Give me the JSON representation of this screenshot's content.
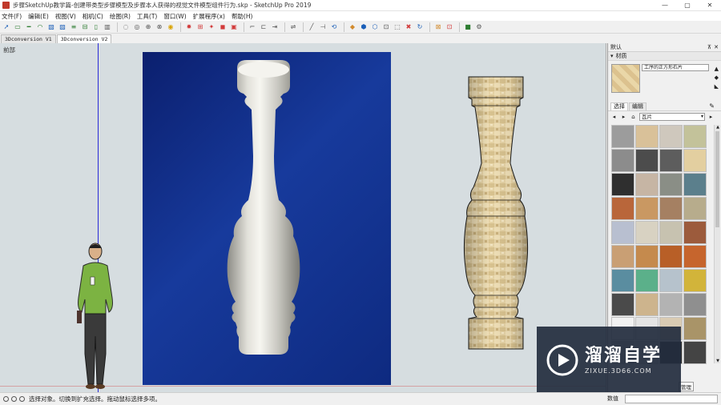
{
  "window": {
    "title": "步骤SketchUp教学篇-创建带类型步骤模型及步骤本人获得的视觉文件模型组件行为.skp - SketchUp Pro 2019",
    "controls": [
      "—",
      "▢",
      "✕"
    ]
  },
  "menu": [
    "文件(F)",
    "编辑(E)",
    "视图(V)",
    "相机(C)",
    "绘图(R)",
    "工具(T)",
    "窗口(W)",
    "扩展程序(x)",
    "帮助(H)"
  ],
  "scene_tabs": [
    {
      "label": "3Dconversion V1",
      "active": false
    },
    {
      "label": "3Dconversion V2",
      "active": true
    }
  ],
  "viewport": {
    "label": "前部",
    "background": "#d6dde0",
    "photo_bg": "#0e2a80"
  },
  "materials_panel": {
    "header": "默认",
    "subheader": "材质",
    "material_name": "工序的正方形石片",
    "tabs": [
      "选择",
      "编辑"
    ],
    "category": "瓦片",
    "manage_label": "管理",
    "swatch_colors": [
      "#9c9c9c",
      "#d9c199",
      "#cfc8bd",
      "#c3c29a",
      "#8c8c8c",
      "#4c4c4c",
      "#5d5d5d",
      "#e3cfa0",
      "#2f2f2f",
      "#c6b5a4",
      "#8a8e86",
      "#5b7f8c",
      "#b9663a",
      "#c99862",
      "#a58062",
      "#b7ac8c",
      "#b8bfd0",
      "#d8d2c2",
      "#c7c2b0",
      "#9c5b3c",
      "#c99f74",
      "#c58a4d",
      "#b85f27",
      "#c6652d",
      "#5a8da0",
      "#5bb08a",
      "#b6c2cc",
      "#d2b43a",
      "#4a4a4a",
      "#cdb48d",
      "#b3b3b3",
      "#8f8f8f",
      "#f2f2f2",
      "#e4e4e4",
      "#d9cbb3",
      "#a99468",
      "#b7b7b7",
      "#cfcfcf",
      "#2d2d2d",
      "#444444"
    ]
  },
  "status": {
    "message": "选择对象。切换到扩充选择。拖动鼠标选择多项。",
    "vcb_label": "数值"
  },
  "watermark": {
    "title": "溜溜自学",
    "url": "ZIXUE.3D66.COM"
  }
}
